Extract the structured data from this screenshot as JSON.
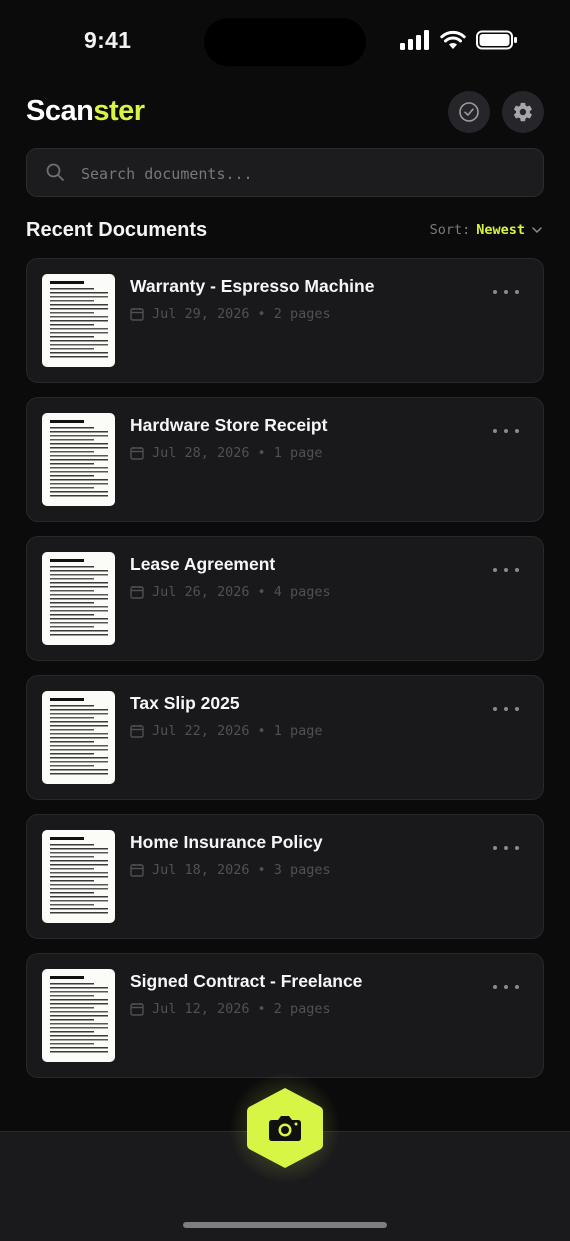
{
  "status_bar": {
    "time": "9:41"
  },
  "header": {
    "logo_part1": "Scan",
    "logo_part2": "ster",
    "accent_color": "#d7f545",
    "icons": [
      "check-circle-icon",
      "gear-icon"
    ]
  },
  "search": {
    "placeholder": "Search documents...",
    "value": ""
  },
  "section": {
    "title": "Recent Documents",
    "sort_label": "Sort:",
    "sort_value": "Newest"
  },
  "documents": [
    {
      "title": "Warranty - Espresso Machine",
      "date": "Jul 29, 2026",
      "pages": "2 pages"
    },
    {
      "title": "Hardware Store Receipt",
      "date": "Jul 28, 2026",
      "pages": "1 page"
    },
    {
      "title": "Lease Agreement",
      "date": "Jul 26, 2026",
      "pages": "4 pages"
    },
    {
      "title": "Tax Slip 2025",
      "date": "Jul 22, 2026",
      "pages": "1 page"
    },
    {
      "title": "Home Insurance Policy",
      "date": "Jul 18, 2026",
      "pages": "3 pages"
    },
    {
      "title": "Signed Contract - Freelance",
      "date": "Jul 12, 2026",
      "pages": "2 pages"
    }
  ],
  "meta_separator": "•",
  "fab": {
    "icon": "camera-icon"
  }
}
